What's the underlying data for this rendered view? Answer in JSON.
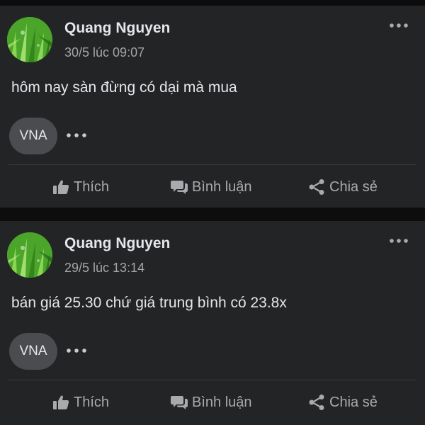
{
  "posts": [
    {
      "author": "Quang Nguyen",
      "time": "30/5 lúc 09:07",
      "content": "hôm nay sàn đừng có dại mà mua",
      "chip": "VNA",
      "actions": {
        "like": "Thích",
        "comment": "Bình luận",
        "share": "Chia sẻ"
      }
    },
    {
      "author": "Quang Nguyen",
      "time": "29/5 lúc 13:14",
      "content": "bán giá 25.30 chứ giá trung bình có 23.8x",
      "chip": "VNA",
      "actions": {
        "like": "Thích",
        "comment": "Bình luận",
        "share": "Chia sẻ"
      }
    }
  ],
  "icons": {
    "avatar": "grass-photo",
    "menu": "more-horizontal-icon",
    "chip_more": "more-horizontal-icon",
    "like": "thumbs-up-icon",
    "comment": "comment-icon",
    "share": "share-icon"
  },
  "colors": {
    "background": "#0d0d0d",
    "card": "#232425",
    "text_primary": "#e4e6eb",
    "text_secondary": "#a3a5a8",
    "chip": "#4a4c4f"
  }
}
